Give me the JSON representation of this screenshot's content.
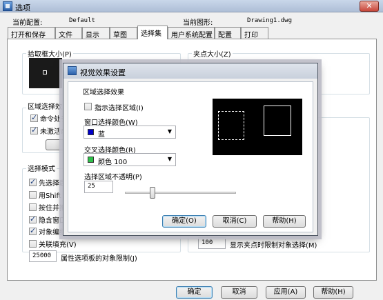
{
  "main": {
    "title": "选项",
    "close_label": "✕",
    "current_profile_label": "当前配置:",
    "current_profile_value": "Default",
    "current_drawing_label": "当前图形:",
    "current_drawing_value": "Drawing1.dwg",
    "tabs": [
      "打开和保存",
      "文件",
      "显示",
      "草图",
      "选择集",
      "用户系统配置",
      "配置",
      "打印"
    ],
    "active_tab": "选择集",
    "pickbox_title": "拾取框大小(P)",
    "grip_size_title": "夹点大小(Z)",
    "preview_title": "区域选择效",
    "command_checkbox": "命令处于",
    "inactive_checkbox": "未激活命",
    "selection_mode_title": "选择模式",
    "mode_items": [
      {
        "label": "先选择后",
        "checked": true
      },
      {
        "label": "用Shift",
        "checked": false
      },
      {
        "label": "按住并拖",
        "checked": false
      },
      {
        "label": "隐含窗口",
        "checked": true
      },
      {
        "label": "对象编组",
        "checked": true
      },
      {
        "label": "关联填充(V)",
        "checked": false
      }
    ],
    "object_limit_value": "25000",
    "object_limit_label": "属性选项板的对象限制(J)",
    "grip_limit_value": "100",
    "grip_limit_label": "显示夹点时限制对象选择(M)",
    "buttons": {
      "ok": "确定",
      "cancel": "取消",
      "apply": "应用(A)",
      "help": "帮助(H)"
    }
  },
  "dialog": {
    "title": "视觉效果设置",
    "group_title": "区域选择效果",
    "indicate_area_label": "指示选择区域(I)",
    "indicate_area_checked": false,
    "window_color_label": "窗口选择颜色(W)",
    "window_color_value": "蓝",
    "window_color": "#0000c8",
    "crossing_color_label": "交叉选择颜色(R)",
    "crossing_color_value": "颜色 100",
    "crossing_color": "#2ec24a",
    "opacity_label": "选择区域不透明(P)",
    "opacity_value": "25",
    "buttons": {
      "ok": "确定(O)",
      "cancel": "取消(C)",
      "help": "帮助(H)"
    }
  }
}
